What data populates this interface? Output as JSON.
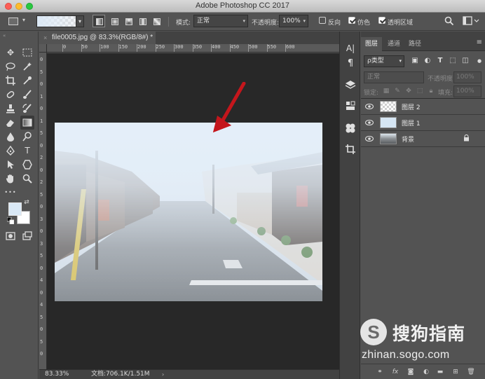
{
  "window": {
    "title": "Adobe Photoshop CC 2017"
  },
  "options_bar": {
    "mode_label": "模式:",
    "mode_value": "正常",
    "opacity_label": "不透明度:",
    "opacity_value": "100%",
    "reverse_label": "反向",
    "reverse_checked": false,
    "dither_label": "仿色",
    "dither_checked": true,
    "transparency_label": "透明区域",
    "transparency_checked": true,
    "gradient_fg_color": "#dbe8f5"
  },
  "document": {
    "tab_title": "file0005.jpg @ 83.3%(RGB/8#) *",
    "close_glyph": "×"
  },
  "ruler": {
    "top_labels": [
      "0",
      "50",
      "100",
      "150",
      "200",
      "250",
      "300",
      "350",
      "400",
      "450",
      "500",
      "550",
      "600"
    ],
    "left_labels": [
      "0",
      "5",
      "0",
      "1",
      "0",
      "1",
      "5",
      "0",
      "2",
      "0",
      "2",
      "5",
      "0",
      "3",
      "0",
      "3",
      "5",
      "0",
      "4",
      "0",
      "4",
      "5",
      "0",
      "5",
      "0"
    ]
  },
  "status": {
    "zoom": "83.33%",
    "doc_info": "文档:706.1K/1.51M",
    "arrow": "›"
  },
  "toolbar": {
    "foreground_color": "#d9e8f5",
    "background_color": "#ffffff",
    "more_glyph": "•••"
  },
  "layers_panel": {
    "tabs": [
      {
        "label": "图层",
        "active": true
      },
      {
        "label": "通道",
        "active": false
      },
      {
        "label": "路径",
        "active": false
      }
    ],
    "filter_label": "ρ类型",
    "blend_mode": "正常",
    "opacity_label": "不透明度:",
    "opacity_value": "100%",
    "lock_label": "锁定:",
    "fill_label": "填充:",
    "fill_value": "100%",
    "layers": [
      {
        "name": "图层 2",
        "thumb": "transparent",
        "locked": false
      },
      {
        "name": "图层 1",
        "thumb": "blue",
        "locked": false
      },
      {
        "name": "背景",
        "thumb": "photo",
        "locked": true
      }
    ]
  },
  "watermark": {
    "logo_letter": "S",
    "brand": "搜狗指南",
    "url": "zhinan.sogo.com"
  },
  "colors": {
    "ui_dark": "#535353",
    "canvas_bg": "#282828",
    "arrow_red": "#c4161c"
  }
}
